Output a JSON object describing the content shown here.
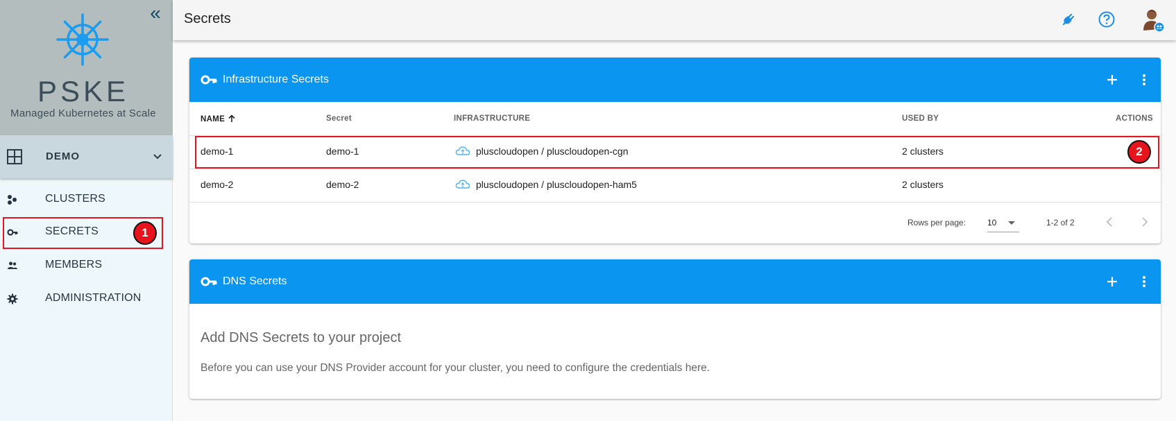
{
  "sidebar": {
    "brand_name": "PSKE",
    "brand_tagline": "Managed Kubernetes at Scale",
    "project_label": "DEMO",
    "nav": [
      {
        "label": "CLUSTERS",
        "icon": "clusters-icon"
      },
      {
        "label": "SECRETS",
        "icon": "key-icon"
      },
      {
        "label": "MEMBERS",
        "icon": "members-icon"
      },
      {
        "label": "ADMINISTRATION",
        "icon": "gear-icon"
      }
    ]
  },
  "header": {
    "title": "Secrets"
  },
  "infra_card": {
    "title": "Infrastructure Secrets",
    "columns": [
      "NAME",
      "Secret",
      "INFRASTRUCTURE",
      "USED BY",
      "ACTIONS"
    ],
    "rows": [
      {
        "name": "demo-1",
        "secret": "demo-1",
        "infrastructure": "pluscloudopen / pluscloudopen-cgn",
        "used_by": "2 clusters"
      },
      {
        "name": "demo-2",
        "secret": "demo-2",
        "infrastructure": "pluscloudopen / pluscloudopen-ham5",
        "used_by": "2 clusters"
      }
    ],
    "pager": {
      "rows_label": "Rows per page:",
      "rows_value": "10",
      "range": "1-2 of 2"
    }
  },
  "dns_card": {
    "title": "DNS Secrets",
    "empty_title": "Add DNS Secrets to your project",
    "empty_text": "Before you can use your DNS Provider account for your cluster, you need to configure the credentials here."
  },
  "annotations": {
    "badge_1": "1",
    "badge_2": "2"
  },
  "colors": {
    "accent": "#0a96f0",
    "highlight": "#e5141d",
    "sidebar_bg": "#eef7fb",
    "brand_bg": "#b4bdbd"
  }
}
